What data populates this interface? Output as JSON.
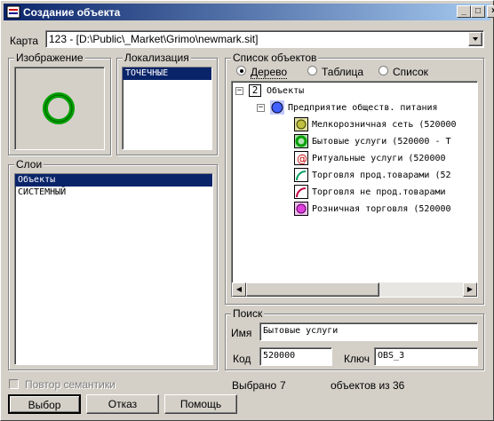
{
  "window": {
    "title": "Создание объекта"
  },
  "titlebar_buttons": {
    "minimize": "_",
    "maximize": "□",
    "close": "×"
  },
  "map": {
    "label": "Карта",
    "value": "123 - [D:\\Public\\_Market\\Grimo\\newmark.sit]"
  },
  "image_group": {
    "title": "Изображение"
  },
  "localization": {
    "title": "Локализация",
    "items": [
      "ТОЧЕЧНЫЕ"
    ]
  },
  "layers": {
    "title": "Слои",
    "items": [
      "Объекты",
      "СИСТЕМНЫЙ"
    ]
  },
  "object_list": {
    "title": "Список объектов",
    "views": [
      "Дерево",
      "Таблица",
      "Список"
    ],
    "tree": {
      "root_number": "2",
      "root_label": "Объекты",
      "group_label": "Предприятие обществ. питания",
      "items": [
        {
          "label": "Мелкорозничная сеть (520000",
          "icon": "small-retail-icon"
        },
        {
          "label": "Бытовые услуги (520000 - Т",
          "icon": "domestic-services-icon"
        },
        {
          "label": "Ритуальные услуги (520000",
          "icon": "ritual-services-icon"
        },
        {
          "label": "Торговля прод.товарами (52",
          "icon": "food-trade-icon"
        },
        {
          "label": "Торговля не прод.товарами",
          "icon": "nonfood-trade-icon"
        },
        {
          "label": "Розничная торговля (520000",
          "icon": "retail-trade-icon"
        }
      ]
    }
  },
  "search": {
    "title": "Поиск",
    "name_label": "Имя",
    "name_value": "Бытовые услуги",
    "code_label": "Код",
    "code_value": "520000",
    "key_label": "Ключ",
    "key_value": "OBS_3"
  },
  "footer": {
    "repeat_semantics": "Повтор семантики",
    "selected_label": "Выбрано",
    "selected_count": "7",
    "objects_of": "объектов из",
    "total_count": "36"
  },
  "buttons": {
    "select": "Выбор",
    "cancel": "Отказ",
    "help": "Помощь"
  }
}
